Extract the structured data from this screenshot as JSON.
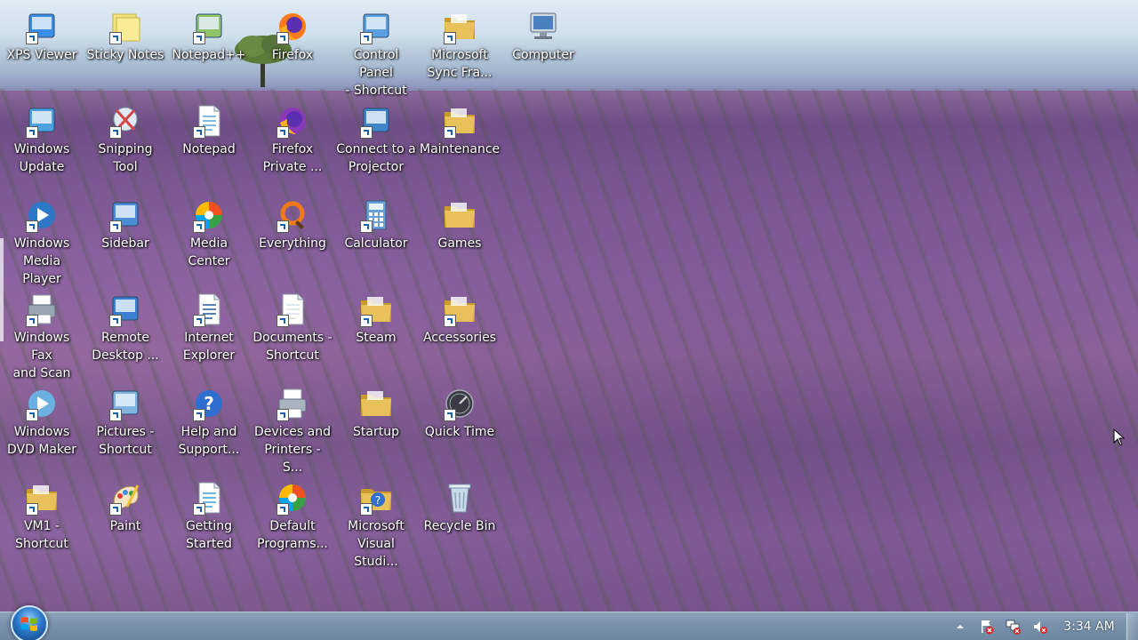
{
  "desktop": {
    "icons": [
      {
        "label": "XPS Viewer",
        "name": "xps-viewer",
        "icon": "xps-viewer-icon",
        "shortcut": true,
        "color": "#3a8ee6",
        "col": 0,
        "row": 0
      },
      {
        "label": "Sticky Notes",
        "name": "sticky-notes",
        "icon": "sticky-notes-icon",
        "shortcut": true,
        "color": "#f3e37a",
        "col": 1,
        "row": 0
      },
      {
        "label": "Notepad++",
        "name": "notepad-plus-plus",
        "icon": "notepad-plus-plus-icon",
        "shortcut": true,
        "color": "#8fc46a",
        "col": 2,
        "row": 0
      },
      {
        "label": "Firefox",
        "name": "firefox",
        "icon": "firefox-icon",
        "shortcut": true,
        "color": "#ff7a1a",
        "col": 3,
        "row": 0
      },
      {
        "label": "Control Panel\n- Shortcut",
        "name": "control-panel-shortcut",
        "icon": "control-panel-icon",
        "shortcut": true,
        "color": "#5a9fe0",
        "col": 4,
        "row": 0
      },
      {
        "label": "Microsoft\nSync Fra...",
        "name": "microsoft-sync-framework",
        "icon": "folder-icon",
        "shortcut": true,
        "color": "#e8c15a",
        "col": 5,
        "row": 0
      },
      {
        "label": "Computer",
        "name": "computer",
        "icon": "computer-icon",
        "shortcut": false,
        "color": "#4a7fc0",
        "col": 6,
        "row": 0
      },
      {
        "label": "Windows\nUpdate",
        "name": "windows-update",
        "icon": "windows-update-icon",
        "shortcut": true,
        "color": "#4aa3df",
        "col": 0,
        "row": 1
      },
      {
        "label": "Snipping\nTool",
        "name": "snipping-tool",
        "icon": "snipping-tool-icon",
        "shortcut": true,
        "color": "#d64545",
        "col": 1,
        "row": 1
      },
      {
        "label": "Notepad",
        "name": "notepad",
        "icon": "notepad-icon",
        "shortcut": true,
        "color": "#7fb9e6",
        "col": 2,
        "row": 1
      },
      {
        "label": "Firefox\nPrivate ...",
        "name": "firefox-private",
        "icon": "firefox-private-icon",
        "shortcut": true,
        "color": "#8a3ab9",
        "col": 3,
        "row": 1
      },
      {
        "label": "Connect to a\nProjector",
        "name": "connect-to-projector",
        "icon": "projector-icon",
        "shortcut": true,
        "color": "#3f86c9",
        "col": 4,
        "row": 1
      },
      {
        "label": "Maintenance",
        "name": "maintenance",
        "icon": "folder-icon",
        "shortcut": true,
        "color": "#e8c15a",
        "col": 5,
        "row": 1
      },
      {
        "label": "Windows\nMedia Player",
        "name": "windows-media-player",
        "icon": "media-player-icon",
        "shortcut": true,
        "color": "#2f78c8",
        "col": 0,
        "row": 2
      },
      {
        "label": "Sidebar",
        "name": "sidebar",
        "icon": "sidebar-icon",
        "shortcut": true,
        "color": "#4b8ed6",
        "col": 1,
        "row": 2
      },
      {
        "label": "Media Center",
        "name": "media-center",
        "icon": "media-center-icon",
        "shortcut": true,
        "color": "#3aa048",
        "col": 2,
        "row": 2
      },
      {
        "label": "Everything",
        "name": "everything",
        "icon": "everything-icon",
        "shortcut": true,
        "color": "#f07a1a",
        "col": 3,
        "row": 2
      },
      {
        "label": "Calculator",
        "name": "calculator",
        "icon": "calculator-icon",
        "shortcut": true,
        "color": "#6aa0d8",
        "col": 4,
        "row": 2
      },
      {
        "label": "Games",
        "name": "games",
        "icon": "folder-icon",
        "shortcut": false,
        "color": "#e8c15a",
        "col": 5,
        "row": 2
      },
      {
        "label": "Windows Fax\nand Scan",
        "name": "windows-fax-and-scan",
        "icon": "fax-icon",
        "shortcut": true,
        "color": "#9aa7b3",
        "col": 0,
        "row": 3
      },
      {
        "label": "Remote\nDesktop ...",
        "name": "remote-desktop",
        "icon": "remote-desktop-icon",
        "shortcut": true,
        "color": "#3a7fd0",
        "col": 1,
        "row": 3
      },
      {
        "label": "Internet\nExplorer",
        "name": "internet-explorer",
        "icon": "document-icon",
        "shortcut": true,
        "color": "#ffffff",
        "col": 2,
        "row": 3
      },
      {
        "label": "Documents -\nShortcut",
        "name": "documents-shortcut",
        "icon": "documents-icon",
        "shortcut": true,
        "color": "#dfe6ee",
        "col": 3,
        "row": 3
      },
      {
        "label": "Steam",
        "name": "steam",
        "icon": "folder-icon",
        "shortcut": true,
        "color": "#e8c15a",
        "col": 4,
        "row": 3
      },
      {
        "label": "Accessories",
        "name": "accessories",
        "icon": "folder-icon",
        "shortcut": true,
        "color": "#e8c15a",
        "col": 5,
        "row": 3
      },
      {
        "label": "Windows\nDVD Maker",
        "name": "windows-dvd-maker",
        "icon": "dvd-maker-icon",
        "shortcut": true,
        "color": "#6ab0e0",
        "col": 0,
        "row": 4
      },
      {
        "label": "Pictures -\nShortcut",
        "name": "pictures-shortcut",
        "icon": "pictures-icon",
        "shortcut": true,
        "color": "#7fb5e0",
        "col": 1,
        "row": 4
      },
      {
        "label": "Help and\nSupport...",
        "name": "help-and-support",
        "icon": "help-icon",
        "shortcut": true,
        "color": "#2f6fd0",
        "col": 2,
        "row": 4
      },
      {
        "label": "Devices and\nPrinters - S...",
        "name": "devices-and-printers",
        "icon": "printer-icon",
        "shortcut": true,
        "color": "#a9b4be",
        "col": 3,
        "row": 4
      },
      {
        "label": "Startup",
        "name": "startup",
        "icon": "folder-icon",
        "shortcut": false,
        "color": "#e8c15a",
        "col": 4,
        "row": 4
      },
      {
        "label": "Quick Time",
        "name": "quick-time",
        "icon": "quicktime-icon",
        "shortcut": true,
        "color": "#3b3b45",
        "col": 5,
        "row": 4
      },
      {
        "label": "VM1 -\nShortcut",
        "name": "vm1-shortcut",
        "icon": "folder-icon",
        "shortcut": true,
        "color": "#e8c15a",
        "col": 0,
        "row": 5
      },
      {
        "label": "Paint",
        "name": "paint",
        "icon": "paint-icon",
        "shortcut": true,
        "color": "#f0c030",
        "col": 1,
        "row": 5
      },
      {
        "label": "Getting\nStarted",
        "name": "getting-started",
        "icon": "getting-started-icon",
        "shortcut": true,
        "color": "#6fb7e3",
        "col": 2,
        "row": 5
      },
      {
        "label": "Default\nPrograms...",
        "name": "default-programs",
        "icon": "default-programs-icon",
        "shortcut": true,
        "color": "#3aa048",
        "col": 3,
        "row": 5
      },
      {
        "label": "Microsoft\nVisual Studi...",
        "name": "microsoft-visual-studio",
        "icon": "help-folder-icon",
        "shortcut": true,
        "color": "#e8c15a",
        "col": 4,
        "row": 5
      },
      {
        "label": "Recycle Bin",
        "name": "recycle-bin",
        "icon": "recycle-bin-icon",
        "shortcut": false,
        "color": "#c9dbe8",
        "col": 5,
        "row": 5
      }
    ]
  },
  "taskbar": {
    "start_icon": "windows-logo-icon",
    "tray": [
      {
        "name": "tray-show-hidden",
        "icon": "chevron-up-icon"
      },
      {
        "name": "tray-action-center",
        "icon": "flag-error-icon"
      },
      {
        "name": "tray-network",
        "icon": "network-error-icon"
      },
      {
        "name": "tray-volume",
        "icon": "volume-muted-icon"
      }
    ],
    "clock": "3:34 AM"
  },
  "colors": {
    "taskbar": "#7a92ab",
    "folder": "#e8c15a",
    "error_red": "#d42a2a",
    "label_text": "#ffffff"
  }
}
